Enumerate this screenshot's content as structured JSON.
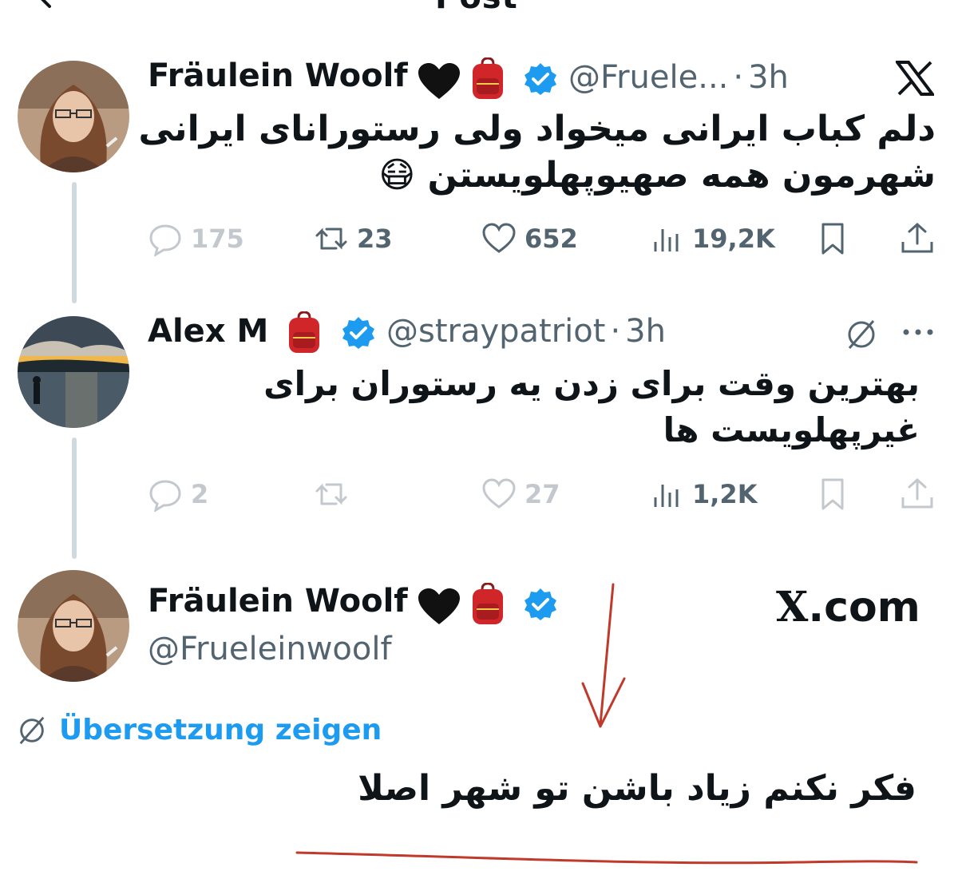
{
  "header": {
    "title": "Post"
  },
  "tweets": [
    {
      "name": "Fräulein Woolf",
      "handle": "@Fruele...",
      "time": "3h",
      "text_line1": "دلم کباب ایرانی میخواد ولی رستورانای ایرانی",
      "text_line2": "شهرمون همه صهیوپهلویستن 😷",
      "replies": "175",
      "reposts": "23",
      "likes": "652",
      "views": "19,2K"
    },
    {
      "name": "Alex M",
      "handle": "@straypatriot",
      "time": "3h",
      "text_line1": "بهترین وقت برای زدن یه رستوران برای",
      "text_line2": "غیرپهلویست ها",
      "replies": "2",
      "likes": "27",
      "views": "1,2K"
    },
    {
      "name": "Fräulein Woolf",
      "handle": "@Frueleinwoolf",
      "translate_label": "Übersetzung zeigen",
      "text_line1": "فکر نکنم زیاد باشن تو شهر اصلا"
    }
  ],
  "watermark": {
    "x": "X",
    "domain": ".com"
  },
  "icons": [
    "back-arrow-icon",
    "x-logo-icon",
    "verified-badge-icon",
    "backpack-emoji-icon",
    "black-heart-emoji-icon",
    "reply-icon",
    "repost-icon",
    "like-icon",
    "views-icon",
    "bookmark-icon",
    "share-icon",
    "grok-icon",
    "more-icon",
    "translate-globe-icon"
  ],
  "colors": {
    "accent": "#1d9bf0",
    "text": "#0f1419",
    "muted": "#536471",
    "annotation": "#c0392b"
  }
}
